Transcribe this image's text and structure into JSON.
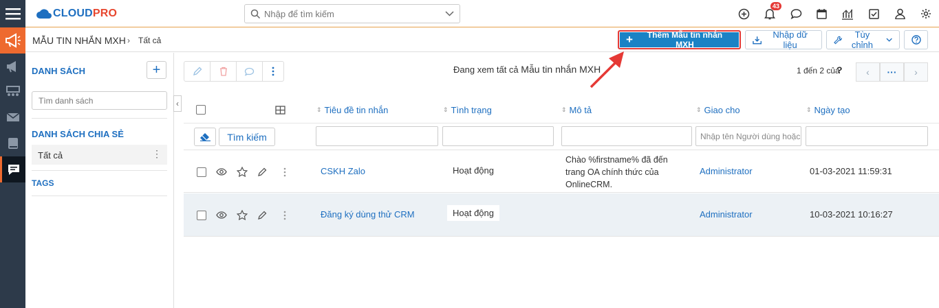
{
  "app": {
    "logo_main": "CLOUD",
    "logo_accent": "PRO"
  },
  "search": {
    "placeholder": "Nhập để tìm kiếm"
  },
  "notifications": {
    "badge": "43"
  },
  "header": {
    "module_title": "MẪU TIN NHẮN MXH",
    "breadcrumb_sep": "›",
    "breadcrumb_current": "Tất cả",
    "add_label": "Thêm Mẫu tin nhắn MXH",
    "import_label": "Nhập dữ liệu",
    "customize_label": "Tùy chỉnh"
  },
  "sidebar": {
    "list_title": "DANH SÁCH",
    "list_search_placeholder": "Tìm danh sách",
    "shared_title": "DANH SÁCH CHIA SẺ",
    "all_item": "Tất cả",
    "tags_title": "TAGS"
  },
  "main": {
    "viewing_prefix": "Đang xem tất cả",
    "viewing_module": "Mẫu tin nhắn MXH",
    "pager_text": "1 đến 2 của",
    "pager_q": "?",
    "columns": [
      "Tiêu đề tin nhắn",
      "Tình trạng",
      "Mô tả",
      "Giao cho",
      "Ngày tạo"
    ],
    "search_button": "Tìm kiếm",
    "assignee_filter_placeholder": "Nhập tên Người dùng hoặc",
    "rows": [
      {
        "title": "CSKH Zalo",
        "status": "Hoạt động",
        "description": "Chào %firstname% đã đến trang OA chính thức của OnlineCRM.",
        "assignee": "Administrator",
        "created": "01-03-2021 11:59:31"
      },
      {
        "title": "Đăng ký dùng thử CRM",
        "status": "Hoạt động",
        "description": "",
        "assignee": "Administrator",
        "created": "10-03-2021 10:16:27"
      }
    ]
  },
  "colors": {
    "accent": "#1e6fc0",
    "brand_red": "#e7462e",
    "highlight": "#e53935",
    "rail": "#2d3a4a",
    "rail_active": "#ee6a2f"
  }
}
